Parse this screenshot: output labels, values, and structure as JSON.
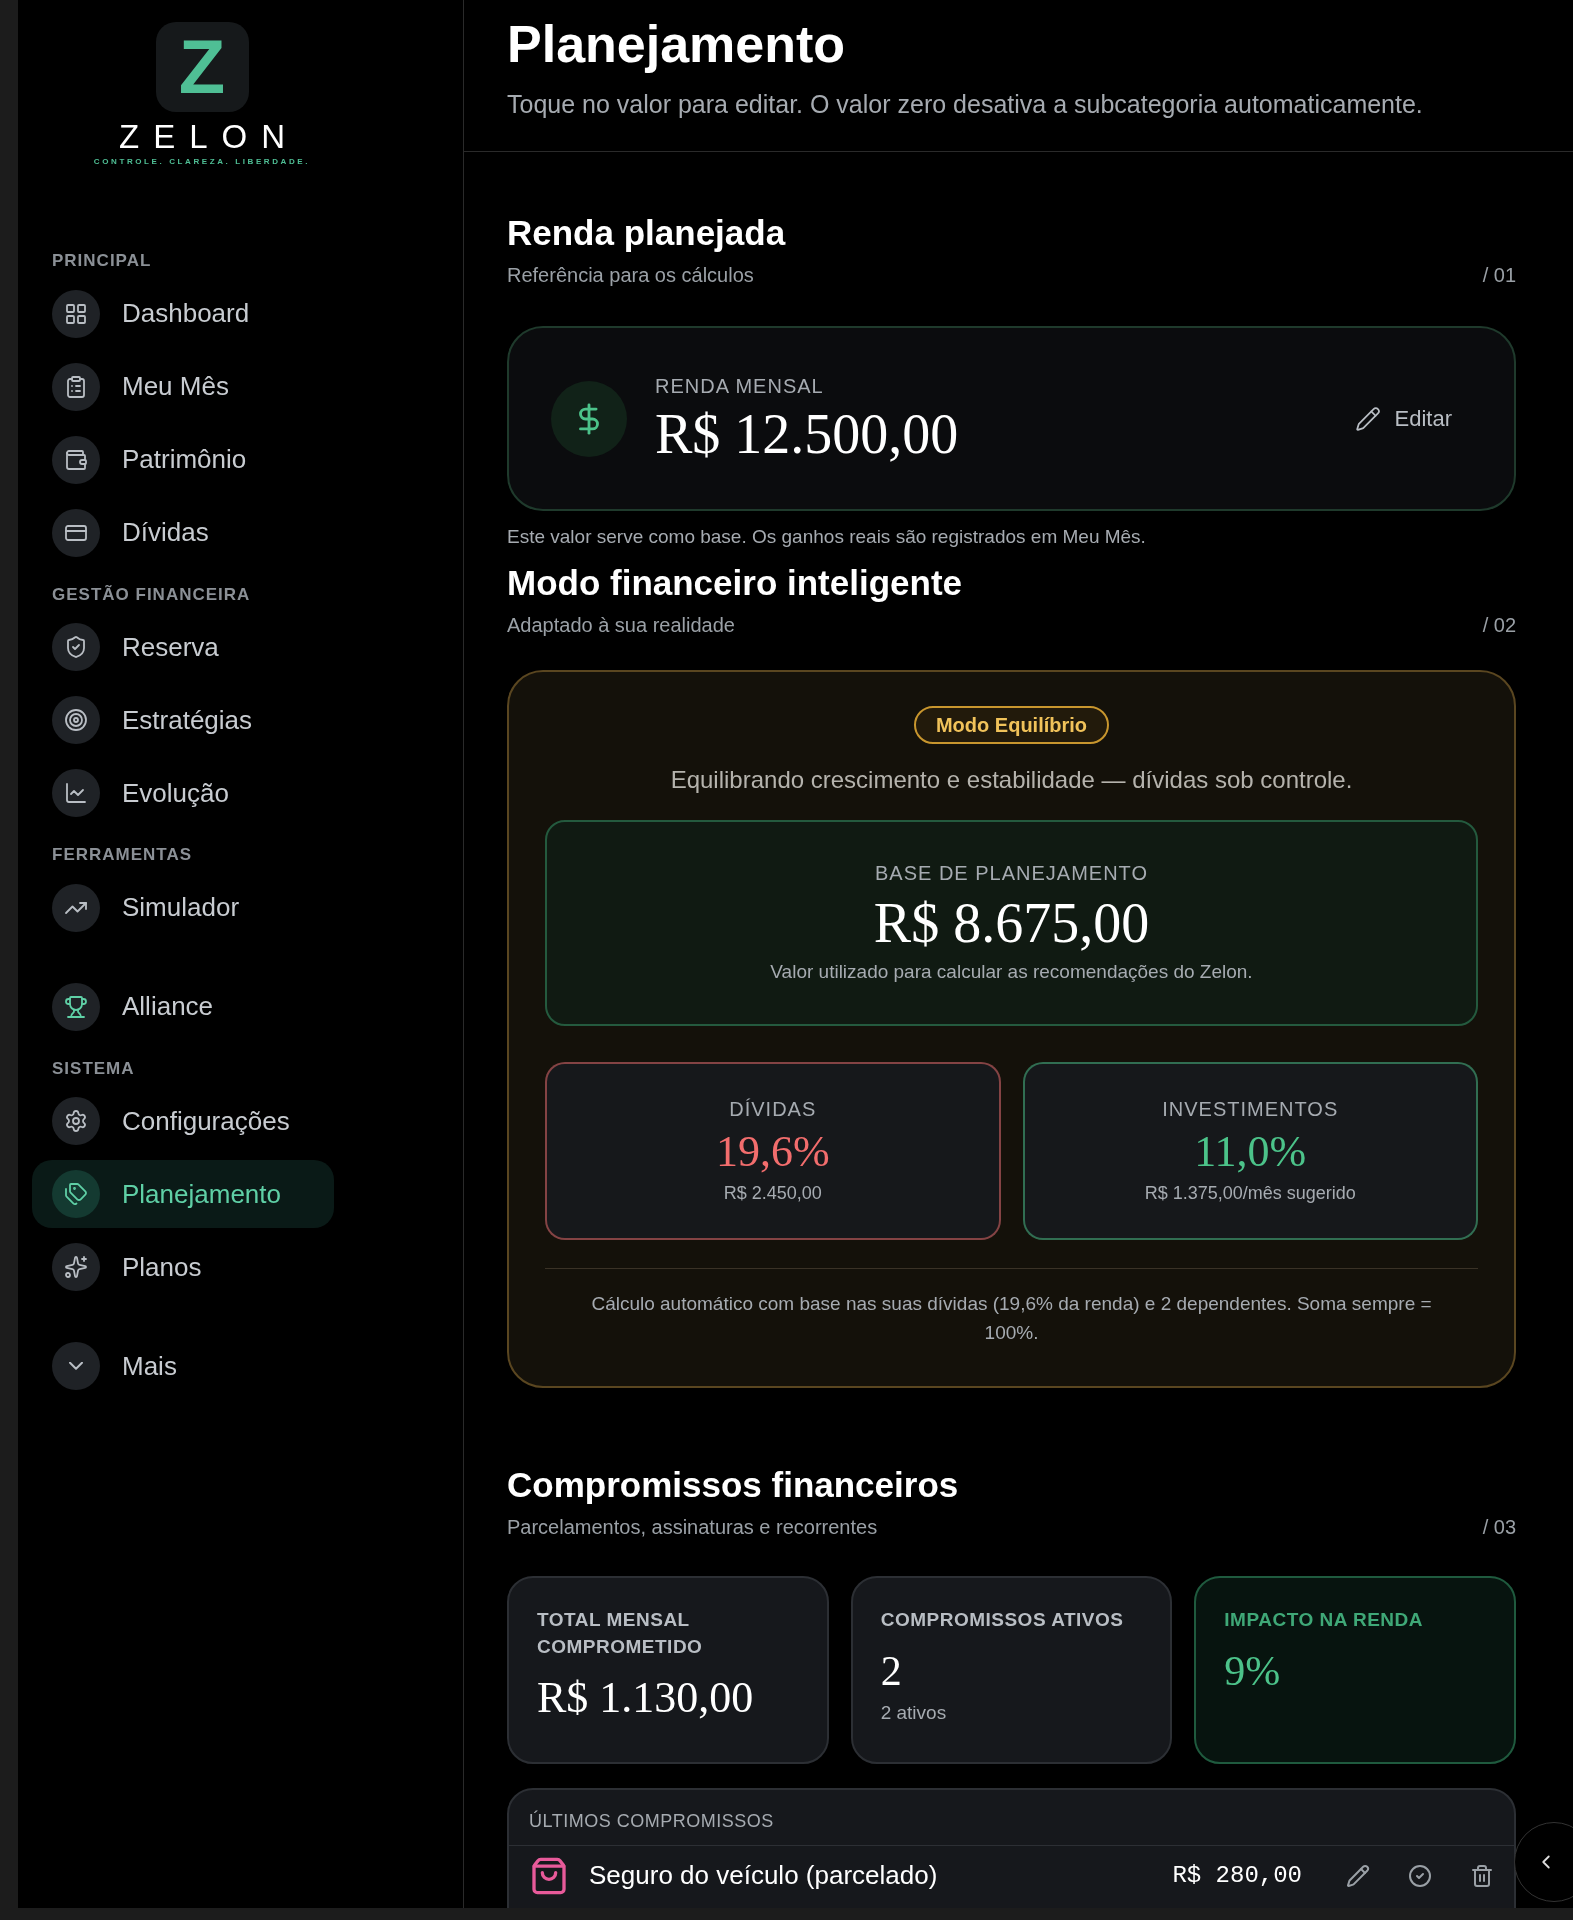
{
  "brand": {
    "letter": "Z",
    "name": "ZELON",
    "tagline": "CONTROLE. CLAREZA. LIBERDADE."
  },
  "sidebar": {
    "groups": [
      {
        "label": "PRINCIPAL",
        "items": [
          {
            "label": "Dashboard",
            "selected": false
          },
          {
            "label": "Meu Mês",
            "selected": false
          },
          {
            "label": "Patrimônio",
            "selected": false
          },
          {
            "label": "Dívidas",
            "selected": false
          }
        ]
      },
      {
        "label": "GESTÃO FINANCEIRA",
        "items": [
          {
            "label": "Reserva",
            "selected": false
          },
          {
            "label": "Estratégias",
            "selected": false
          },
          {
            "label": "Evolução",
            "selected": false
          }
        ]
      },
      {
        "label": "FERRAMENTAS",
        "items": [
          {
            "label": "Simulador",
            "selected": false
          }
        ]
      },
      {
        "items": [
          {
            "label": "Alliance",
            "selected": false
          }
        ]
      },
      {
        "label": "SISTEMA",
        "items": [
          {
            "label": "Configurações",
            "selected": false
          },
          {
            "label": "Planejamento",
            "selected": true
          },
          {
            "label": "Planos",
            "selected": false
          }
        ]
      },
      {
        "items": [
          {
            "label": "Mais",
            "selected": false
          }
        ]
      }
    ]
  },
  "header": {
    "title": "Planejamento",
    "subtitle": "Toque no valor para editar. O valor zero desativa a subcategoria automaticamente."
  },
  "income": {
    "title": "Renda planejada",
    "subtitle": "Referência para os cálculos",
    "number": "/ 01",
    "label": "RENDA MENSAL",
    "value": "R$ 12.500,00",
    "edit": "Editar",
    "note": "Este valor serve como base. Os ganhos reais são registrados em Meu Mês."
  },
  "mode": {
    "title": "Modo financeiro inteligente",
    "subtitle": "Adaptado à sua realidade",
    "number": "/ 02",
    "badge": "Modo Equilíbrio",
    "description": "Equilibrando crescimento e estabilidade — dívidas sob controle.",
    "base": {
      "label": "BASE DE PLANEJAMENTO",
      "value": "R$ 8.675,00",
      "note": "Valor utilizado para calcular as recomendações do Zelon."
    },
    "stats": [
      {
        "label": "DÍVIDAS",
        "value": "19,6%",
        "detail": "R$ 2.450,00",
        "color": "#f26d6d"
      },
      {
        "label": "INVESTIMENTOS",
        "value": "11,0%",
        "detail": "R$ 1.375,00/mês sugerido",
        "color": "#4cc38a"
      }
    ],
    "footnote": "Cálculo automático com base nas suas dívidas (19,6% da renda) e 2 dependentes. Soma sempre = 100%."
  },
  "commitments": {
    "title": "Compromissos financeiros",
    "subtitle": "Parcelamentos, assinaturas e recorrentes",
    "number": "/ 03",
    "cards": [
      {
        "label": "TOTAL MENSAL COMPROMETIDO",
        "value": "R$ 1.130,00",
        "highlight": false
      },
      {
        "label": "COMPROMISSOS ATIVOS",
        "value": "2",
        "detail": "2 ativos",
        "highlight": false
      },
      {
        "label": "IMPACTO NA RENDA",
        "value": "9%",
        "highlight": true
      }
    ],
    "list_title": "ÚLTIMOS COMPROMISSOS",
    "rows": [
      {
        "name": "Seguro do veículo (parcelado)",
        "amount": "R$ 280,00"
      }
    ]
  }
}
